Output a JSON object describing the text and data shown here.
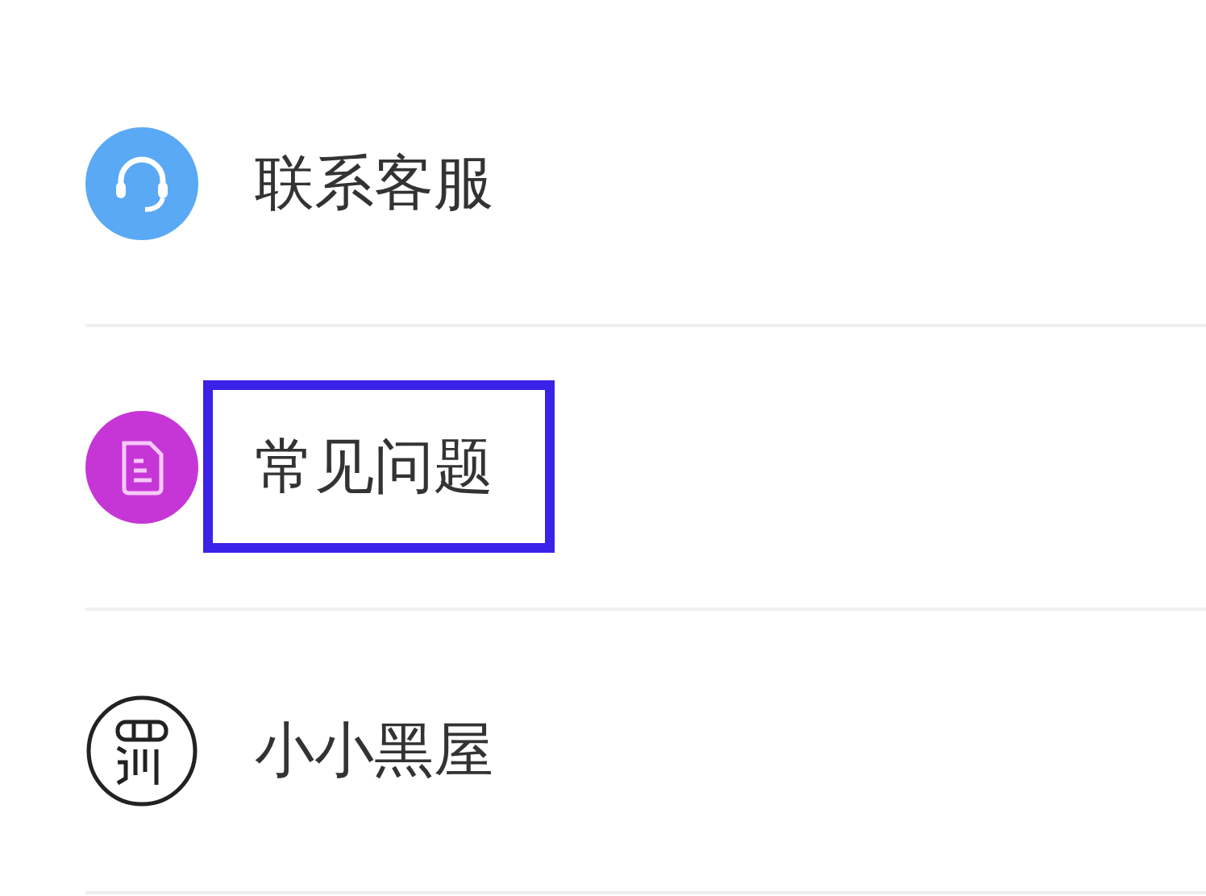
{
  "menu_items": [
    {
      "kind": "headset",
      "label": "联系客服",
      "highlighted": false
    },
    {
      "kind": "document",
      "label": "常见问题",
      "highlighted": true
    },
    {
      "kind": "penalty",
      "label": "小小黑屋",
      "highlighted": false
    }
  ]
}
